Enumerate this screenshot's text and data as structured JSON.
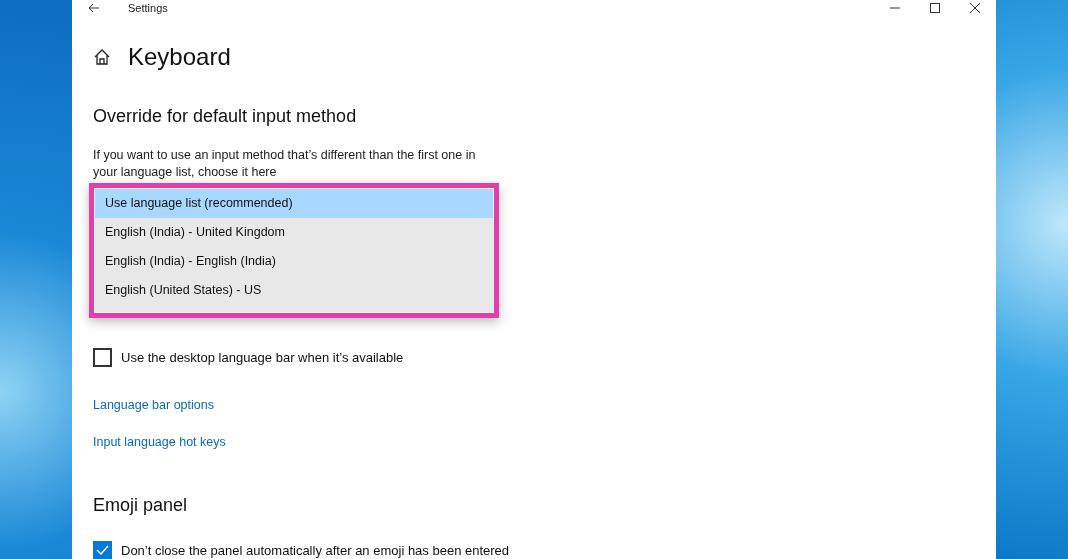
{
  "window": {
    "title": "Settings"
  },
  "page": {
    "title": "Keyboard"
  },
  "override_section": {
    "heading": "Override for default input method",
    "description": "If you want to use an input method that’s different than the first one in your language list, choose it here",
    "dropdown_options": [
      {
        "label": "Use language list (recommended)",
        "selected": true
      },
      {
        "label": "English (India) - United Kingdom",
        "selected": false
      },
      {
        "label": "English (India) - English (India)",
        "selected": false
      },
      {
        "label": "English (United States) - US",
        "selected": false
      }
    ]
  },
  "language_bar_checkbox": {
    "label": "Use the desktop language bar when it’s available",
    "checked": false
  },
  "links": [
    "Language bar options",
    "Input language hot keys"
  ],
  "emoji_section": {
    "heading": "Emoji panel",
    "checkbox": {
      "label": "Don’t close the panel automatically after an emoji has been entered",
      "checked": true
    }
  }
}
